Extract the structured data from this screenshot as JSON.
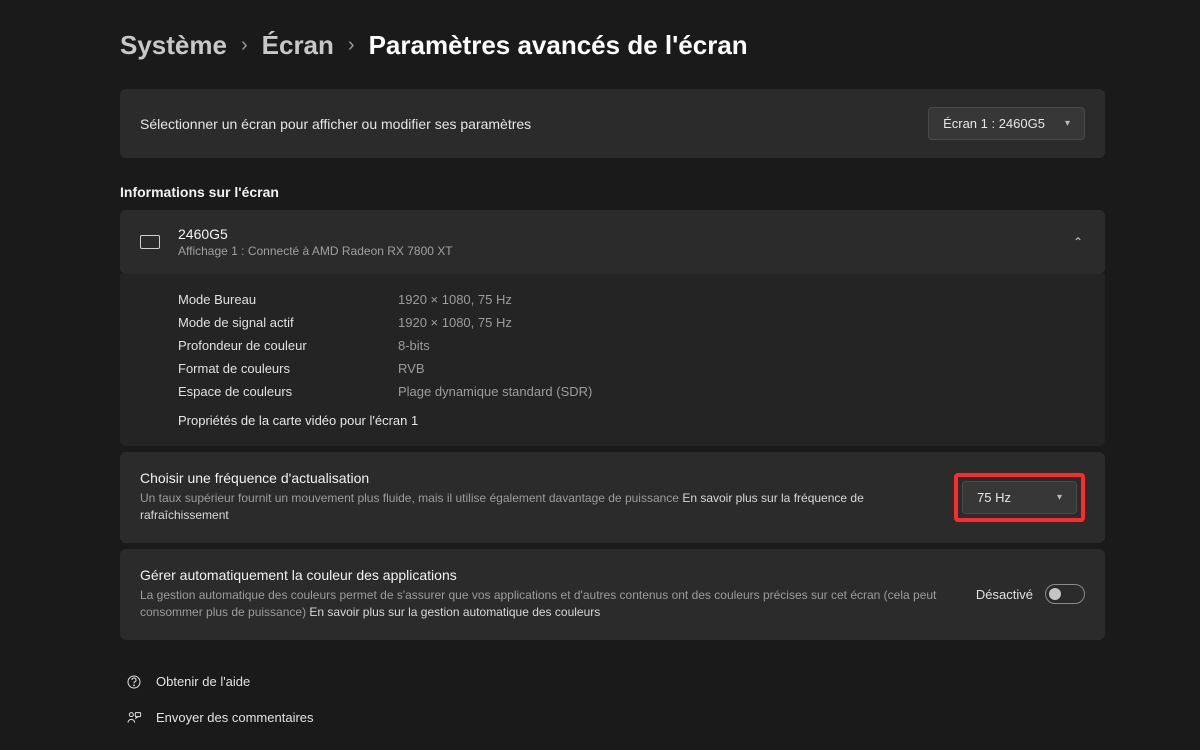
{
  "breadcrumb": {
    "level1": "Système",
    "level2": "Écran",
    "level3": "Paramètres avancés de l'écran"
  },
  "selector": {
    "label": "Sélectionner un écran pour afficher ou modifier ses paramètres",
    "selected": "Écran 1 : 2460G5"
  },
  "info_section_title": "Informations sur l'écran",
  "display": {
    "name": "2460G5",
    "connection": "Affichage 1 : Connecté à AMD Radeon RX 7800 XT",
    "rows": [
      {
        "label": "Mode Bureau",
        "value": "1920 × 1080, 75 Hz"
      },
      {
        "label": "Mode de signal actif",
        "value": "1920 × 1080, 75 Hz"
      },
      {
        "label": "Profondeur de couleur",
        "value": "8-bits"
      },
      {
        "label": "Format de couleurs",
        "value": "RVB"
      },
      {
        "label": "Espace de couleurs",
        "value": "Plage dynamique standard (SDR)"
      }
    ],
    "video_props_link": "Propriétés de la carte vidéo pour l'écran 1"
  },
  "refresh": {
    "title": "Choisir une fréquence d'actualisation",
    "desc": "Un taux supérieur fournit un mouvement plus fluide, mais il utilise également davantage de puissance ",
    "learn_more": "En savoir plus sur la fréquence de rafraîchissement",
    "value": "75 Hz"
  },
  "color": {
    "title": "Gérer automatiquement la couleur des applications",
    "desc": "La gestion automatique des couleurs permet de s'assurer que vos applications et d'autres contenus ont des couleurs précises sur cet écran (cela peut consommer plus de puissance) ",
    "learn_more": "En savoir plus sur la gestion automatique des couleurs",
    "state": "Désactivé"
  },
  "footer": {
    "help": "Obtenir de l'aide",
    "feedback": "Envoyer des commentaires"
  }
}
